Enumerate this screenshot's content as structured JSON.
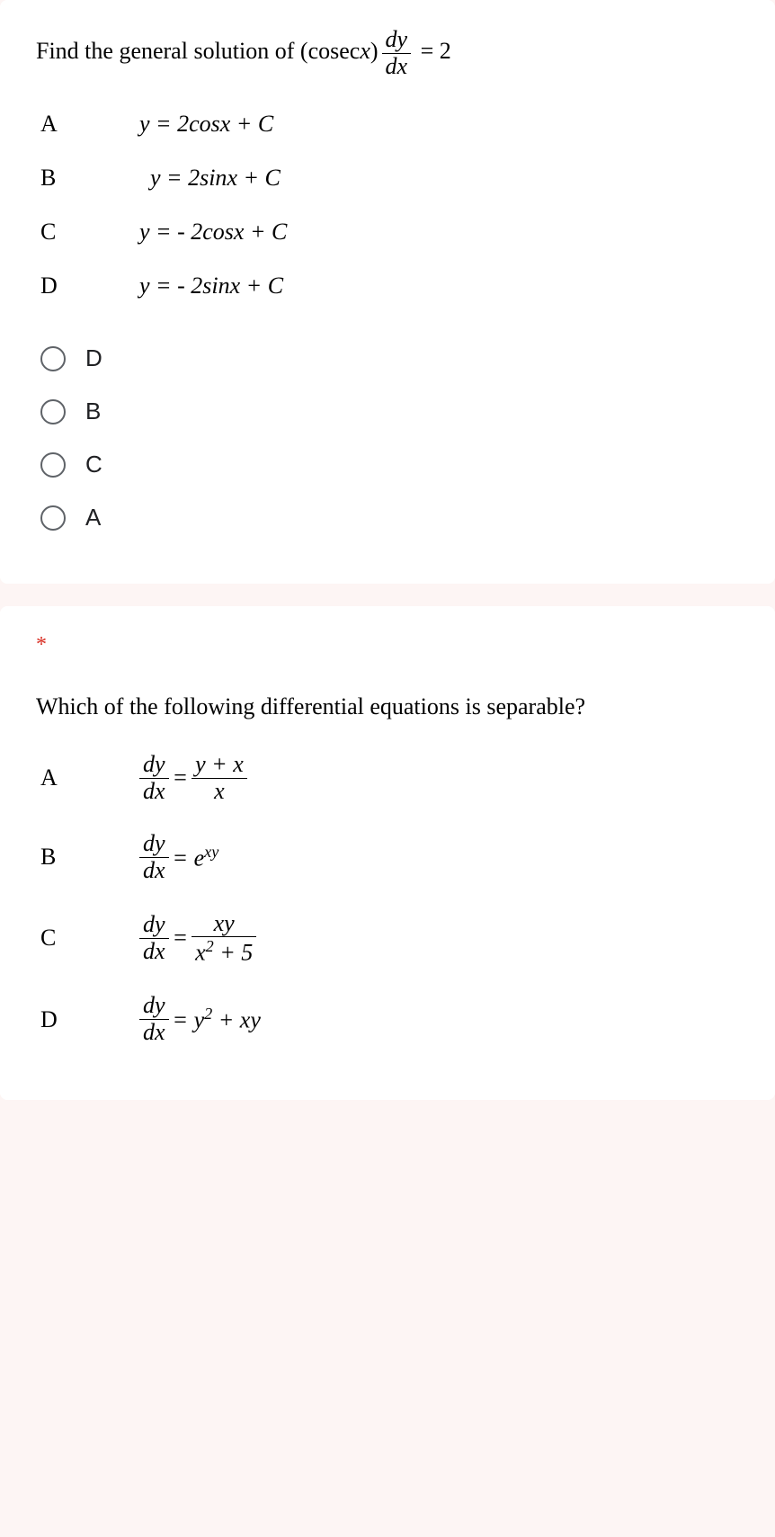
{
  "question1": {
    "prompt_prefix": "Find the general solution of ",
    "prompt_equation": "(cosec x) dy/dx = 2",
    "options": {
      "A": {
        "letter": "A",
        "formula": "y = 2cos x + C"
      },
      "B": {
        "letter": "B",
        "formula": "y = 2sin x + C"
      },
      "C": {
        "letter": "C",
        "formula": "y = - 2cos x + C"
      },
      "D": {
        "letter": "D",
        "formula": "y = - 2sin x + C"
      }
    },
    "answer_choices": [
      "D",
      "B",
      "C",
      "A"
    ]
  },
  "question2": {
    "required_marker": "*",
    "prompt": "Which of the following differential equations is separable?",
    "options": {
      "A": {
        "letter": "A",
        "formula": "dy/dx = (y+x)/x"
      },
      "B": {
        "letter": "B",
        "formula": "dy/dx = e^(xy)"
      },
      "C": {
        "letter": "C",
        "formula": "dy/dx = xy/(x^2+5)"
      },
      "D": {
        "letter": "D",
        "formula": "dy/dx = y^2 + xy"
      }
    }
  },
  "chart_data": {
    "type": "table",
    "description": "Multiple choice quiz questions on differential equations",
    "questions": [
      {
        "text": "Find the general solution of (cosec x)(dy/dx) = 2",
        "choices": [
          {
            "id": "A",
            "text": "y = 2cos x + C"
          },
          {
            "id": "B",
            "text": "y = 2sin x + C"
          },
          {
            "id": "C",
            "text": "y = -2cos x + C"
          },
          {
            "id": "D",
            "text": "y = -2sin x + C"
          }
        ],
        "answer_order": [
          "D",
          "B",
          "C",
          "A"
        ]
      },
      {
        "text": "Which of the following differential equations is separable?",
        "required": true,
        "choices": [
          {
            "id": "A",
            "text": "dy/dx = (y+x)/x"
          },
          {
            "id": "B",
            "text": "dy/dx = e^(xy)"
          },
          {
            "id": "C",
            "text": "dy/dx = xy/(x^2+5)"
          },
          {
            "id": "D",
            "text": "dy/dx = y^2 + xy"
          }
        ]
      }
    ]
  }
}
